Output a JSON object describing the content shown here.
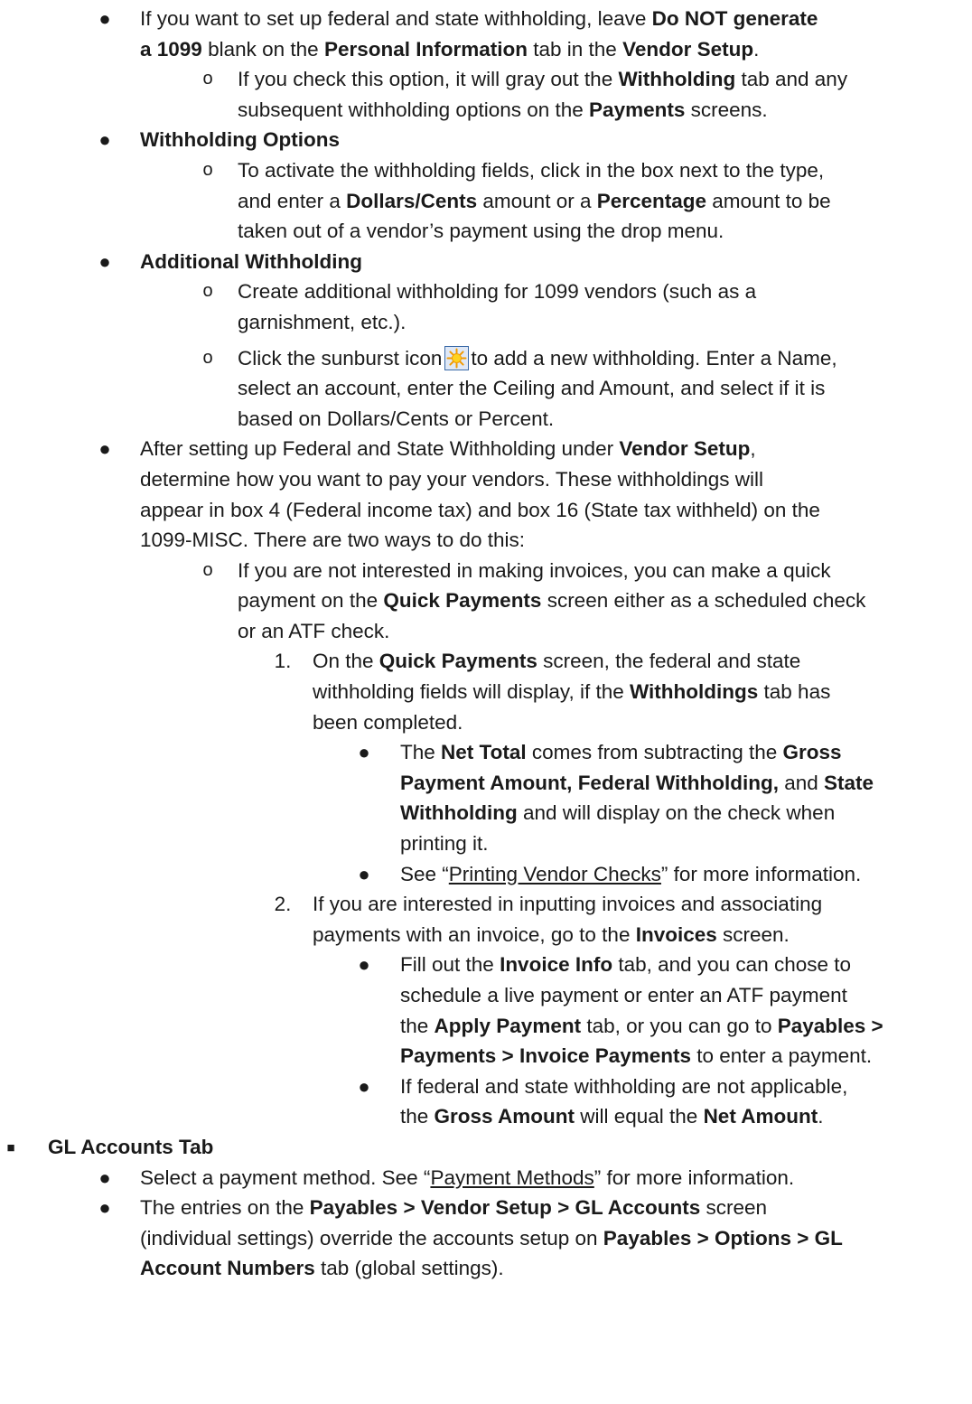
{
  "markers": {
    "bullet": "●",
    "circle": "o",
    "square": "■",
    "num1": "1.",
    "num2": "2."
  },
  "p1": {
    "l1": [
      "If you want to set up federal and state withholding, leave ",
      "Do NOT generate"
    ],
    "l2": [
      "a 1099",
      " blank on the ",
      "Personal Information",
      " tab in the ",
      "Vendor Setup",
      "."
    ],
    "s1": [
      "If you check this option, it will gray out the ",
      "Withholding",
      " tab and any"
    ],
    "s2": [
      "subsequent withholding options on the ",
      "Payments",
      " screens."
    ]
  },
  "p2": {
    "title": "Withholding Options",
    "s1": "To activate the withholding fields, click in the box next to the type,",
    "s2": [
      "and enter a ",
      "Dollars/Cents",
      " amount or a ",
      "Percentage",
      " amount to be"
    ],
    "s3": "taken out of a vendor’s payment using the drop menu."
  },
  "p3": {
    "title": "Additional Withholding",
    "a1": "Create additional withholding for 1099 vendors (such as a",
    "a2": "garnishment, etc.).",
    "b1": [
      "Click the sunburst icon",
      "to add a new withholding. Enter a Name,"
    ],
    "b2": "select an account, enter the Ceiling and Amount, and select if it is",
    "b3": "based on Dollars/Cents or Percent."
  },
  "p4": {
    "l1": [
      "After setting up Federal and State Withholding under ",
      "Vendor Setup",
      ","
    ],
    "l2": "determine how you want to pay your vendors. These withholdings will",
    "l3": "appear in box 4 (Federal income tax) and box 16 (State tax withheld) on the",
    "l4": "1099-MISC. There are two ways to do this:",
    "q1": "If you are not interested in making invoices, you can make a quick",
    "q2": [
      "payment on the ",
      "Quick Payments",
      " screen either as a scheduled check"
    ],
    "q3": "or an ATF check.",
    "n1a": [
      "On the ",
      "Quick Payments",
      " screen, the federal and state"
    ],
    "n1b": [
      "withholding fields will display, if the ",
      "Withholdings",
      " tab has"
    ],
    "n1c": "been completed.",
    "n1d1": [
      "The ",
      "Net Total",
      " comes from subtracting the ",
      "Gross"
    ],
    "n1d2": [
      "Payment Amount, Federal Withholding,",
      " and ",
      "State"
    ],
    "n1d3": [
      "Withholding",
      " and will display on the check when"
    ],
    "n1d4": "printing it.",
    "n1e": [
      "See “",
      "Printing Vendor Checks",
      "” for more information."
    ],
    "n2a": "If you are interested in inputting invoices and associating",
    "n2b": [
      "payments with an invoice, go to the ",
      "Invoices",
      " screen."
    ],
    "n2c1": [
      "Fill out the ",
      "Invoice Info",
      " tab, and you can chose to"
    ],
    "n2c2": "schedule a live payment or enter an ATF payment",
    "n2c3": [
      "the ",
      "Apply Payment",
      " tab, or you can go to ",
      "Payables >"
    ],
    "n2c4": [
      "Payments > Invoice Payments",
      " to enter a payment."
    ],
    "n2d1": "If federal and state withholding are not applicable,",
    "n2d2": [
      "the ",
      "Gross Amount",
      " will equal the ",
      "Net Amount",
      "."
    ]
  },
  "gl": {
    "title": "GL Accounts Tab",
    "b1": [
      "Select a payment method. See “",
      "Payment Methods",
      "” for more information."
    ],
    "b2": [
      "The entries on the ",
      "Payables > Vendor Setup > GL Accounts",
      " screen"
    ],
    "b3": [
      "(individual settings) override the accounts setup on ",
      "Payables > Options > GL"
    ],
    "b4": [
      "Account Numbers",
      " tab (global settings)."
    ]
  }
}
